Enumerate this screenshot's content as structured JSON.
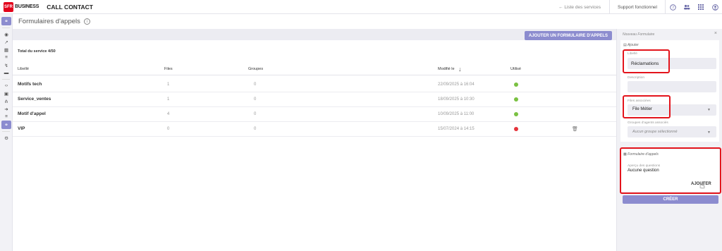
{
  "topbar": {
    "logo_text": "SFR",
    "brand": "BUSINESS",
    "app_title": "CALL CONTACT",
    "services_link": "← Liste des services",
    "support_link": "Support fonctionnel",
    "icons": [
      "help-icon",
      "users-icon",
      "apps-grid-icon",
      "account-icon"
    ]
  },
  "sidebar": {
    "items": [
      "headset-icon",
      "eye-icon",
      "trend-icon",
      "save-icon",
      "list-icon",
      "route-icon",
      "folder-icon",
      "code-icon",
      "calendar-icon",
      "network-icon",
      "forward-icon",
      "queue-icon",
      "headset-active-icon",
      "settings-icon"
    ]
  },
  "page": {
    "title": "Formulaires d'appels",
    "info": "i"
  },
  "toolbar": {
    "add_form_label": "AJOUTER UN FORMULAIRE D'APPELS"
  },
  "table": {
    "total": "Total du service 4/50",
    "columns": {
      "libelle": "Libellé",
      "files": "Files",
      "groupes": "Groupes",
      "modifie": "Modifié le",
      "utilise": "Utilisé"
    },
    "sort_arrow": "↓",
    "rows": [
      {
        "name": "Motifs tech",
        "files": "1",
        "groupes": "0",
        "date": "22/09/2025 à 16:04",
        "used": "green"
      },
      {
        "name": "Service_ventes",
        "files": "1",
        "groupes": "0",
        "date": "18/09/2025 à 10:30",
        "used": "green"
      },
      {
        "name": "Motif d'appel",
        "files": "4",
        "groupes": "0",
        "date": "10/09/2025 à 11:00",
        "used": "green"
      },
      {
        "name": "VIP",
        "files": "0",
        "groupes": "0",
        "date": "15/07/2024 à 14:15",
        "used": "red"
      }
    ]
  },
  "colors": {
    "accent": "#8c8ccf",
    "used_green": "#7ac142",
    "used_red": "#e5333b",
    "highlight_red": "#e3141c"
  },
  "panel": {
    "header": "Nouveau Formulaire",
    "close": "×",
    "add_section": {
      "title": "Ajouter",
      "libelle_label": "Libellé",
      "libelle_value": "Réclamations",
      "description_label": "Description",
      "description_value": "",
      "files_label": "Files associées",
      "files_value": "File Métier",
      "groups_label": "Groupes d'agents associés",
      "groups_value": "Aucun groupe sélectionné"
    },
    "form_section": {
      "title": "Formulaire d'appels",
      "preview_label": "Aperçu des questions",
      "preview_value": "Aucune question",
      "add_button": "AJOUTER"
    },
    "create_button": "CRÉER"
  }
}
